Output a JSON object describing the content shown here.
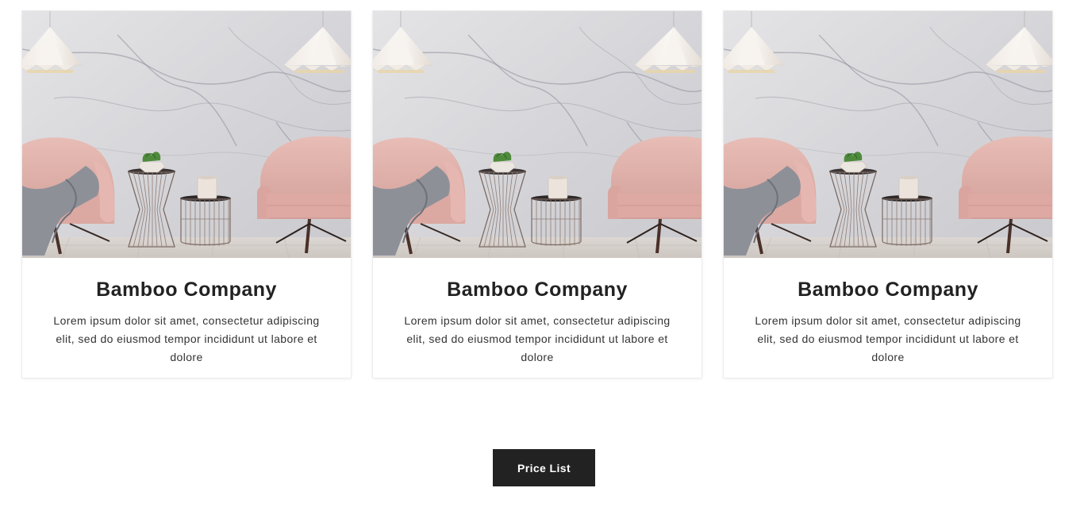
{
  "cards": [
    {
      "title": "Bamboo Company",
      "text": "Lorem ipsum dolor sit amet, consectetur adipiscing elit, sed do eiusmod tempor incididunt ut labore et dolore"
    },
    {
      "title": "Bamboo Company",
      "text": "Lorem ipsum dolor sit amet, consectetur adipiscing elit, sed do eiusmod tempor incididunt ut labore et dolore"
    },
    {
      "title": "Bamboo Company",
      "text": "Lorem ipsum dolor sit amet, consectetur adipiscing elit, sed do eiusmod tempor incididunt ut labore et dolore"
    }
  ],
  "price_button": {
    "label": "Price List"
  },
  "colors": {
    "button_bg": "#222222",
    "title_text": "#222222",
    "chair": "#e0b3ac",
    "wall": "#d9d9dc"
  }
}
